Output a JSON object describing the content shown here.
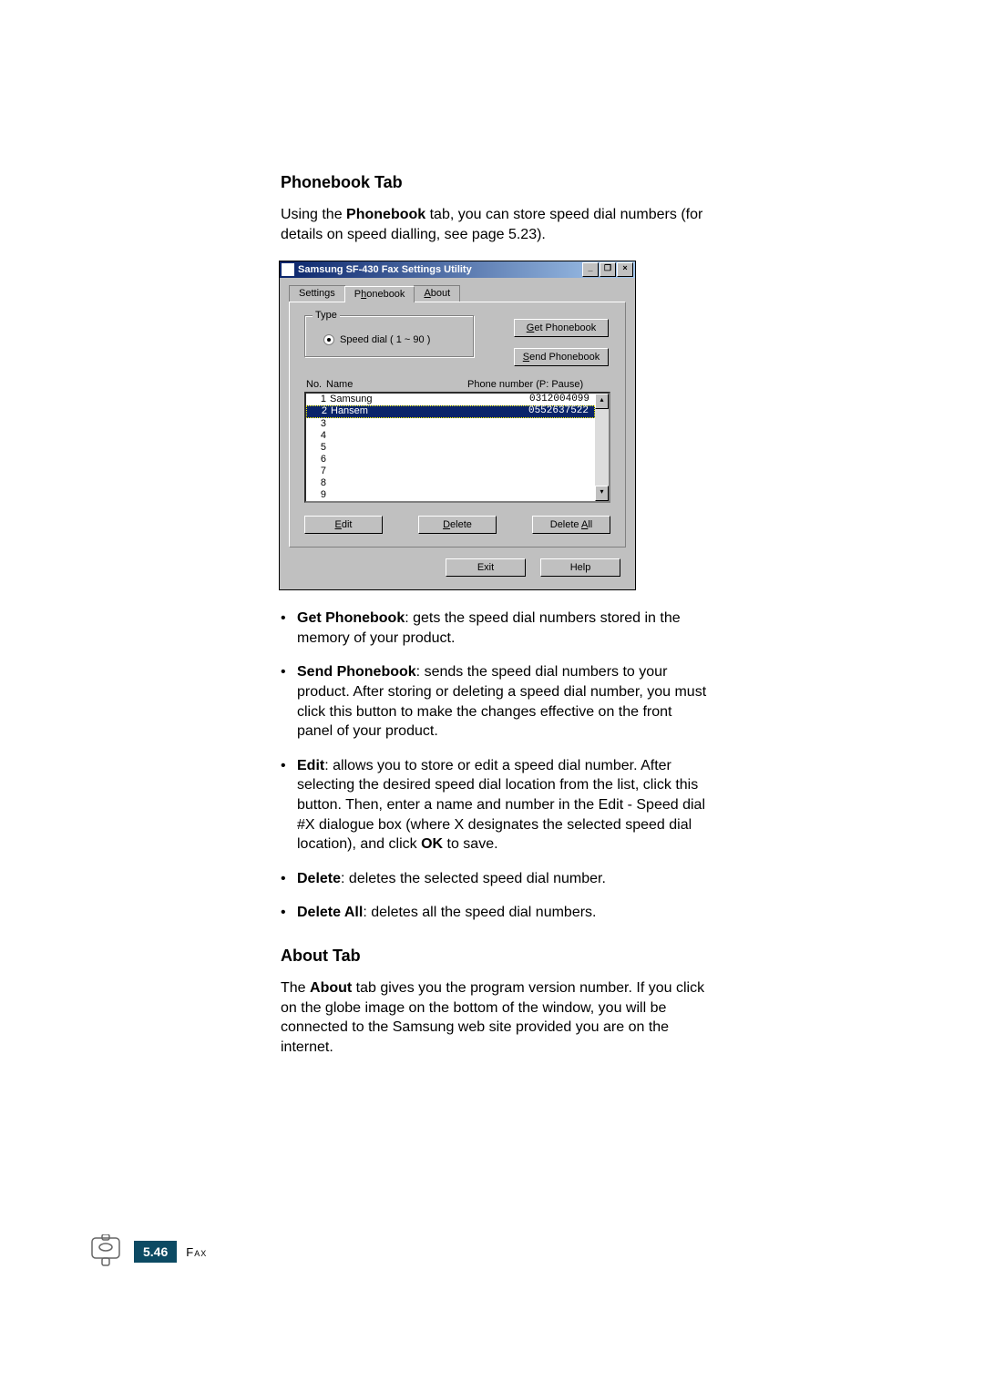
{
  "section1": {
    "heading": "Phonebook Tab",
    "intro_pre": "Using the ",
    "intro_bold": "Phonebook",
    "intro_post": " tab, you can store speed dial numbers (for details on speed dialling, see page 5.23)."
  },
  "dialog": {
    "title": "Samsung SF-430 Fax Settings Utility",
    "winbtns": {
      "minimize": "_",
      "restore": "❐",
      "close": "×"
    },
    "tabs": {
      "settings": "Settings",
      "phonebook_pre": "P",
      "phonebook_u": "h",
      "phonebook_post": "onebook",
      "about_u": "A",
      "about_post": "bout"
    },
    "type_group": {
      "legend_u": "T",
      "legend_post": "ype",
      "radio_label": "Speed dial ( 1 ~ 90 )"
    },
    "rightbtns": {
      "get_u": "G",
      "get_post": "et Phonebook",
      "send_u": "S",
      "send_post": "end Phonebook"
    },
    "list_headers": {
      "no": "No.",
      "name": "Name",
      "phone": "Phone number (P: Pause)"
    },
    "rows": [
      {
        "no": "1",
        "name": "Samsung",
        "phone": "0312004099",
        "selected": false
      },
      {
        "no": "2",
        "name": "Hansem",
        "phone": "0552637522",
        "selected": true
      },
      {
        "no": "3",
        "name": "",
        "phone": "",
        "selected": false
      },
      {
        "no": "4",
        "name": "",
        "phone": "",
        "selected": false
      },
      {
        "no": "5",
        "name": "",
        "phone": "",
        "selected": false
      },
      {
        "no": "6",
        "name": "",
        "phone": "",
        "selected": false
      },
      {
        "no": "7",
        "name": "",
        "phone": "",
        "selected": false
      },
      {
        "no": "8",
        "name": "",
        "phone": "",
        "selected": false
      },
      {
        "no": "9",
        "name": "",
        "phone": "",
        "selected": false
      }
    ],
    "actionbtns": {
      "edit_u": "E",
      "edit_post": "dit",
      "delete_u": "D",
      "delete_post": "elete",
      "deleteall_pre": "Delete ",
      "deleteall_u": "A",
      "deleteall_post": "ll"
    },
    "bottom": {
      "exit": "Exit",
      "help": "Help"
    }
  },
  "bullets": {
    "b1_bold": "Get Phonebook",
    "b1_text": ": gets the speed dial numbers stored in the memory of your product.",
    "b2_bold": "Send Phonebook",
    "b2_text": ": sends the speed dial numbers to your product. After storing or deleting a speed dial number, you must click this button to make the changes effective on the front panel of your product.",
    "b3_bold": "Edit",
    "b3_text": ": allows you to store or edit a speed dial number. After selecting the desired speed dial location from the list, click this button. Then, enter a name and number in the Edit - Speed dial #X dialogue box (where X designates the selected speed dial location), and click ",
    "b3_bold2": "OK",
    "b3_tail": " to save.",
    "b4_bold": "Delete",
    "b4_text": ": deletes the selected speed dial number.",
    "b5_bold": "Delete All",
    "b5_text": ": deletes all the speed dial numbers."
  },
  "section2": {
    "heading": "About Tab",
    "para_pre": "The ",
    "para_bold": "About",
    "para_post": " tab gives you the program version number. If you click on the globe image on the bottom of the window, you will be connected to the Samsung web site provided you are on the internet."
  },
  "footer": {
    "page": "5.46",
    "label": "Fax"
  }
}
